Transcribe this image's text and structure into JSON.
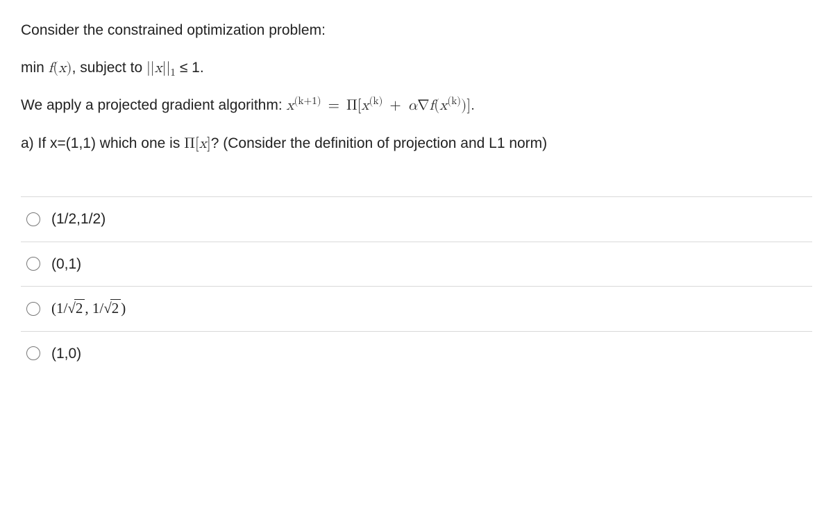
{
  "question": {
    "intro": "Consider the constrained optimization problem:",
    "objective_prefix": "min ",
    "objective_f": "f",
    "objective_var": "x",
    "subject_to": ", subject to ",
    "norm_open": "||",
    "norm_var": "x",
    "norm_close": "||",
    "norm_sub": "1",
    "leq": " ≤ 1.",
    "algo_prefix": "We apply a projected gradient algorithm: ",
    "xk1_base": "x",
    "xk1_exp": "(k+1)",
    "eq": " = ",
    "Pi": "Π",
    "lbr": "[",
    "xk_base": "x",
    "xk_exp": "(k)",
    "plus": " + ",
    "alpha": "α",
    "nabla": "∇",
    "f2": "f",
    "lpar": "(",
    "xk2_base": "x",
    "xk2_exp": "(k)",
    "rpar": ")",
    "rbr": "]",
    "period": ".",
    "part_a_pre": "a) If x=(1,1) which one is ",
    "part_a_pi": "Π",
    "part_a_lbr": "[",
    "part_a_x": "x",
    "part_a_rbr": "]",
    "part_a_post": "? (Consider the definition of projection and L1 norm)"
  },
  "options": [
    {
      "type": "plain",
      "label": "(1/2,1/2)"
    },
    {
      "type": "plain",
      "label": "(0,1)"
    },
    {
      "type": "sqrt",
      "open": "(1/",
      "rad1": "2",
      "mid": ", 1/",
      "rad2": "2",
      "close": ")"
    },
    {
      "type": "plain",
      "label": "(1,0)"
    }
  ]
}
